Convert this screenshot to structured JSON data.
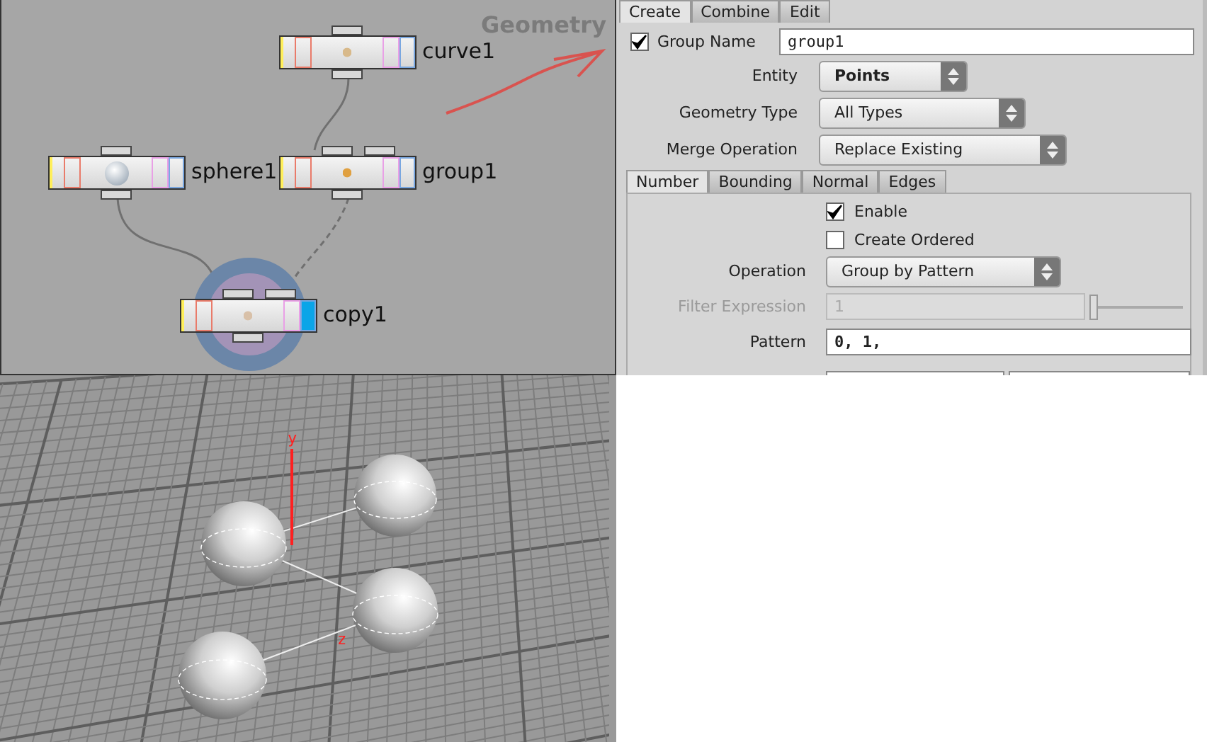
{
  "network": {
    "label": "Geometry",
    "nodes": [
      {
        "name": "curve1",
        "kind": "curve",
        "display_flag": false,
        "ring": false
      },
      {
        "name": "sphere1",
        "kind": "sphere",
        "display_flag": false,
        "ring": false
      },
      {
        "name": "group1",
        "kind": "group",
        "display_flag": false,
        "ring": false
      },
      {
        "name": "copy1",
        "kind": "copy",
        "display_flag": true,
        "ring": true
      }
    ]
  },
  "parameters": {
    "tabs": [
      {
        "label": "Create",
        "selected": true
      },
      {
        "label": "Combine",
        "selected": false
      },
      {
        "label": "Edit",
        "selected": false
      }
    ],
    "group_name": {
      "label": "Group Name",
      "checked": true,
      "value": "group1"
    },
    "dropdowns": [
      {
        "label": "Entity",
        "value": "Points",
        "bold": true
      },
      {
        "label": "Geometry Type",
        "value": "All Types",
        "bold": false
      },
      {
        "label": "Merge Operation",
        "value": "Replace Existing",
        "bold": false
      }
    ],
    "subtabs": [
      {
        "label": "Number",
        "selected": true
      },
      {
        "label": "Bounding",
        "selected": false
      },
      {
        "label": "Normal",
        "selected": false
      },
      {
        "label": "Edges",
        "selected": false
      }
    ],
    "checkboxes": [
      {
        "label": "Enable",
        "checked": true
      },
      {
        "label": "Create Ordered",
        "checked": false
      }
    ],
    "operation": {
      "label": "Operation",
      "value": "Group by Pattern"
    },
    "filter_expression": {
      "label": "Filter Expression",
      "value": "1",
      "disabled": true,
      "level": 0
    },
    "pattern": {
      "label": "Pattern",
      "value": "0, 1,"
    }
  },
  "viewport": {
    "axis_labels": [
      "y",
      "z"
    ]
  }
}
